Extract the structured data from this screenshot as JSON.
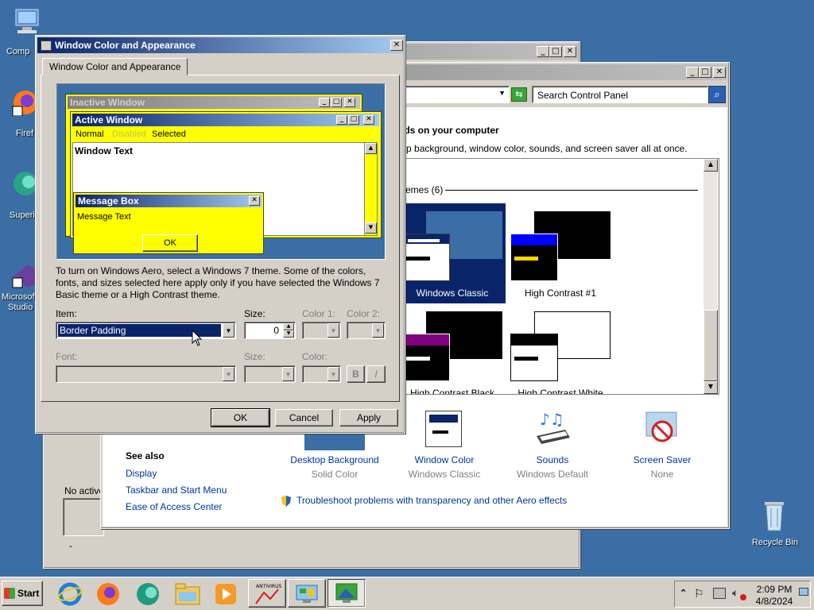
{
  "desktop": {
    "icons": [
      {
        "label": "Comp"
      },
      {
        "label": "Firef"
      },
      {
        "label": "Superi"
      },
      {
        "label": "Microsof"
      },
      {
        "label": "Studio !"
      },
      {
        "label": "Recycle Bin"
      }
    ]
  },
  "back_window": {
    "no_active_label": "No active",
    "dash": "-"
  },
  "control_panel": {
    "search_placeholder": "Search Control Panel",
    "heading": "nds on your computer",
    "subtext": "top background, window color, sounds, and screen saver all at once.",
    "themes_group": "emes (6)",
    "themes": [
      {
        "label": "Windows Classic"
      },
      {
        "label": "High Contrast #1"
      },
      {
        "label": "High Contrast Black"
      },
      {
        "label": "High Contrast White"
      }
    ],
    "see_also": "See also",
    "links": [
      "Display",
      "Taskbar and Start Menu",
      "Ease of Access Center"
    ],
    "bottom_items": [
      {
        "label": "Desktop Background",
        "sub": "Solid Color"
      },
      {
        "label": "Window Color",
        "sub": "Windows Classic"
      },
      {
        "label": "Sounds",
        "sub": "Windows Default"
      },
      {
        "label": "Screen Saver",
        "sub": "None"
      }
    ],
    "troubleshoot": "Troubleshoot problems with transparency and other Aero effects"
  },
  "dialog": {
    "title": "Window Color and Appearance",
    "tab": "Window Color and Appearance",
    "preview": {
      "inactive": "Inactive Window",
      "active": "Active Window",
      "menu_normal": "Normal",
      "menu_disabled": "Disabled",
      "menu_selected": "Selected",
      "window_text": "Window Text",
      "msgbox_title": "Message Box",
      "msgbox_text": "Message Text",
      "msgbox_ok": "OK"
    },
    "description": "To turn on Windows Aero, select a Windows 7 theme.  Some of the colors, fonts, and sizes selected here apply only if you have selected the Windows 7 Basic theme or a High Contrast theme.",
    "item_label": "Item:",
    "item_value": "Border Padding",
    "size_label": "Size:",
    "size_value": "0",
    "color1_label": "Color 1:",
    "color2_label": "Color 2:",
    "font_label": "Font:",
    "font_size_label": "Size:",
    "font_color_label": "Color:",
    "bold": "B",
    "italic": "I",
    "ok": "OK",
    "cancel": "Cancel",
    "apply": "Apply"
  },
  "taskbar": {
    "start": "Start",
    "time": "2:09 PM",
    "date": "4/8/2024"
  },
  "colors": {
    "desktop": "#3a6ea5",
    "preview_yellow": "#ffff00",
    "title_active": "#0a246a",
    "selected_blue": "#0a246a"
  }
}
